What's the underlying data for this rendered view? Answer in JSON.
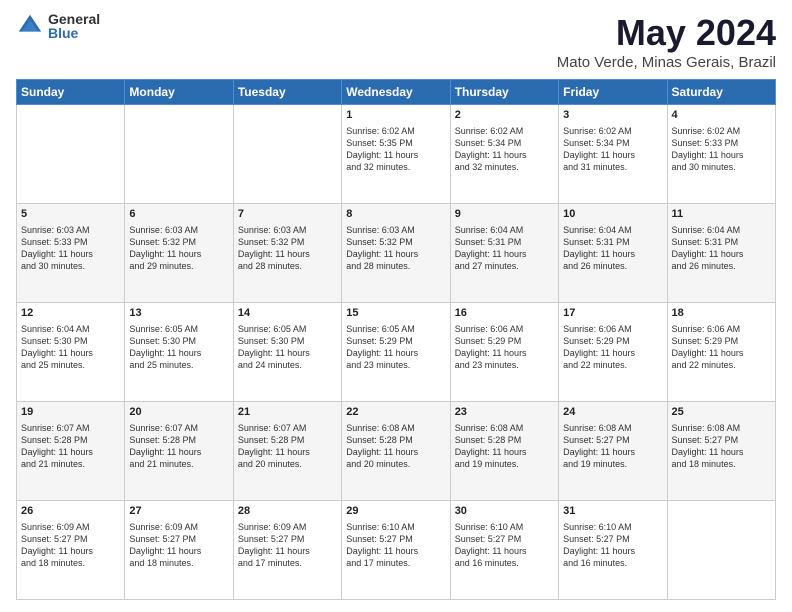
{
  "logo": {
    "general": "General",
    "blue": "Blue"
  },
  "title": {
    "month_year": "May 2024",
    "location": "Mato Verde, Minas Gerais, Brazil"
  },
  "headers": [
    "Sunday",
    "Monday",
    "Tuesday",
    "Wednesday",
    "Thursday",
    "Friday",
    "Saturday"
  ],
  "weeks": [
    [
      {
        "day": "",
        "info": ""
      },
      {
        "day": "",
        "info": ""
      },
      {
        "day": "",
        "info": ""
      },
      {
        "day": "1",
        "info": "Sunrise: 6:02 AM\nSunset: 5:35 PM\nDaylight: 11 hours\nand 32 minutes."
      },
      {
        "day": "2",
        "info": "Sunrise: 6:02 AM\nSunset: 5:34 PM\nDaylight: 11 hours\nand 32 minutes."
      },
      {
        "day": "3",
        "info": "Sunrise: 6:02 AM\nSunset: 5:34 PM\nDaylight: 11 hours\nand 31 minutes."
      },
      {
        "day": "4",
        "info": "Sunrise: 6:02 AM\nSunset: 5:33 PM\nDaylight: 11 hours\nand 30 minutes."
      }
    ],
    [
      {
        "day": "5",
        "info": "Sunrise: 6:03 AM\nSunset: 5:33 PM\nDaylight: 11 hours\nand 30 minutes."
      },
      {
        "day": "6",
        "info": "Sunrise: 6:03 AM\nSunset: 5:32 PM\nDaylight: 11 hours\nand 29 minutes."
      },
      {
        "day": "7",
        "info": "Sunrise: 6:03 AM\nSunset: 5:32 PM\nDaylight: 11 hours\nand 28 minutes."
      },
      {
        "day": "8",
        "info": "Sunrise: 6:03 AM\nSunset: 5:32 PM\nDaylight: 11 hours\nand 28 minutes."
      },
      {
        "day": "9",
        "info": "Sunrise: 6:04 AM\nSunset: 5:31 PM\nDaylight: 11 hours\nand 27 minutes."
      },
      {
        "day": "10",
        "info": "Sunrise: 6:04 AM\nSunset: 5:31 PM\nDaylight: 11 hours\nand 26 minutes."
      },
      {
        "day": "11",
        "info": "Sunrise: 6:04 AM\nSunset: 5:31 PM\nDaylight: 11 hours\nand 26 minutes."
      }
    ],
    [
      {
        "day": "12",
        "info": "Sunrise: 6:04 AM\nSunset: 5:30 PM\nDaylight: 11 hours\nand 25 minutes."
      },
      {
        "day": "13",
        "info": "Sunrise: 6:05 AM\nSunset: 5:30 PM\nDaylight: 11 hours\nand 25 minutes."
      },
      {
        "day": "14",
        "info": "Sunrise: 6:05 AM\nSunset: 5:30 PM\nDaylight: 11 hours\nand 24 minutes."
      },
      {
        "day": "15",
        "info": "Sunrise: 6:05 AM\nSunset: 5:29 PM\nDaylight: 11 hours\nand 23 minutes."
      },
      {
        "day": "16",
        "info": "Sunrise: 6:06 AM\nSunset: 5:29 PM\nDaylight: 11 hours\nand 23 minutes."
      },
      {
        "day": "17",
        "info": "Sunrise: 6:06 AM\nSunset: 5:29 PM\nDaylight: 11 hours\nand 22 minutes."
      },
      {
        "day": "18",
        "info": "Sunrise: 6:06 AM\nSunset: 5:29 PM\nDaylight: 11 hours\nand 22 minutes."
      }
    ],
    [
      {
        "day": "19",
        "info": "Sunrise: 6:07 AM\nSunset: 5:28 PM\nDaylight: 11 hours\nand 21 minutes."
      },
      {
        "day": "20",
        "info": "Sunrise: 6:07 AM\nSunset: 5:28 PM\nDaylight: 11 hours\nand 21 minutes."
      },
      {
        "day": "21",
        "info": "Sunrise: 6:07 AM\nSunset: 5:28 PM\nDaylight: 11 hours\nand 20 minutes."
      },
      {
        "day": "22",
        "info": "Sunrise: 6:08 AM\nSunset: 5:28 PM\nDaylight: 11 hours\nand 20 minutes."
      },
      {
        "day": "23",
        "info": "Sunrise: 6:08 AM\nSunset: 5:28 PM\nDaylight: 11 hours\nand 19 minutes."
      },
      {
        "day": "24",
        "info": "Sunrise: 6:08 AM\nSunset: 5:27 PM\nDaylight: 11 hours\nand 19 minutes."
      },
      {
        "day": "25",
        "info": "Sunrise: 6:08 AM\nSunset: 5:27 PM\nDaylight: 11 hours\nand 18 minutes."
      }
    ],
    [
      {
        "day": "26",
        "info": "Sunrise: 6:09 AM\nSunset: 5:27 PM\nDaylight: 11 hours\nand 18 minutes."
      },
      {
        "day": "27",
        "info": "Sunrise: 6:09 AM\nSunset: 5:27 PM\nDaylight: 11 hours\nand 18 minutes."
      },
      {
        "day": "28",
        "info": "Sunrise: 6:09 AM\nSunset: 5:27 PM\nDaylight: 11 hours\nand 17 minutes."
      },
      {
        "day": "29",
        "info": "Sunrise: 6:10 AM\nSunset: 5:27 PM\nDaylight: 11 hours\nand 17 minutes."
      },
      {
        "day": "30",
        "info": "Sunrise: 6:10 AM\nSunset: 5:27 PM\nDaylight: 11 hours\nand 16 minutes."
      },
      {
        "day": "31",
        "info": "Sunrise: 6:10 AM\nSunset: 5:27 PM\nDaylight: 11 hours\nand 16 minutes."
      },
      {
        "day": "",
        "info": ""
      }
    ]
  ]
}
